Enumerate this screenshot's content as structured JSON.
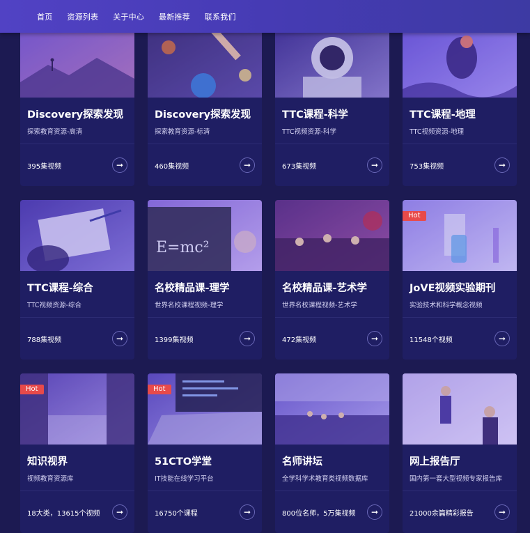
{
  "nav": {
    "items": [
      {
        "label": "首页"
      },
      {
        "label": "资源列表"
      },
      {
        "label": "关于中心"
      },
      {
        "label": "最新推荐"
      },
      {
        "label": "联系我们"
      }
    ]
  },
  "cards": [
    {
      "title": "Discovery探索发现",
      "sub": "探索教育资源-高清",
      "count": "395集视频",
      "hot": "",
      "theme": "mountain",
      "c1": "#7a5ac9",
      "c2": "#b57ab8"
    },
    {
      "title": "Discovery探索发现",
      "sub": "探索教育资源-标清",
      "count": "460集视频",
      "hot": "",
      "theme": "planets",
      "c1": "#3a2d6e",
      "c2": "#5a4ba0"
    },
    {
      "title": "TTC课程-科学",
      "sub": "TTC视频资源-科学",
      "count": "673集视频",
      "hot": "",
      "theme": "astronaut",
      "c1": "#3c2f8a",
      "c2": "#8c7fc7"
    },
    {
      "title": "TTC课程-地理",
      "sub": "TTC视频资源-地理",
      "count": "753集视频",
      "hot": "",
      "theme": "diver",
      "c1": "#6c58d6",
      "c2": "#a593f0"
    },
    {
      "title": "TTC课程-综合",
      "sub": "TTC视频资源-综合",
      "count": "788集视频",
      "hot": "",
      "theme": "writing",
      "c1": "#4a3aa8",
      "c2": "#8577d6"
    },
    {
      "title": "名校精品课-理学",
      "sub": "世界名校课程视频-理学",
      "count": "1399集视频",
      "hot": "",
      "theme": "blackboard",
      "c1": "#8c70d8",
      "c2": "#c8b2f0"
    },
    {
      "title": "名校精品课-艺术学",
      "sub": "世界名校课程视频-艺术学",
      "count": "472集视频",
      "hot": "",
      "theme": "orchestra",
      "c1": "#5a2d7a",
      "c2": "#9a4f9a"
    },
    {
      "title": "JoVE视频实验期刊",
      "sub": "实验技术和科学概念视频",
      "count": "11548个视频",
      "hot": "Hot",
      "theme": "lab",
      "c1": "#9a8be8",
      "c2": "#d7d0f8"
    },
    {
      "title": "知识视界",
      "sub": "视频教育资源库",
      "count": "18大类，13615个视频",
      "hot": "Hot",
      "theme": "library",
      "c1": "#5a46b0",
      "c2": "#a897e0"
    },
    {
      "title": "51CTO学堂",
      "sub": "IT技能在线学习平台",
      "count": "16750个课程",
      "hot": "Hot",
      "theme": "laptop",
      "c1": "#5a4ab8",
      "c2": "#a69ae6"
    },
    {
      "title": "名师讲坛",
      "sub": "全学科学术教育类视频数据库",
      "count": "800位名师，5万集视频",
      "hot": "",
      "theme": "lecture",
      "c1": "#6a5ac8",
      "c2": "#b8aef0"
    },
    {
      "title": "网上报告厅",
      "sub": "国内第一套大型视频专家报告库",
      "count": "21000余篇精彩报告",
      "hot": "",
      "theme": "presenter",
      "c1": "#9a86e0",
      "c2": "#e0d6fa"
    }
  ]
}
